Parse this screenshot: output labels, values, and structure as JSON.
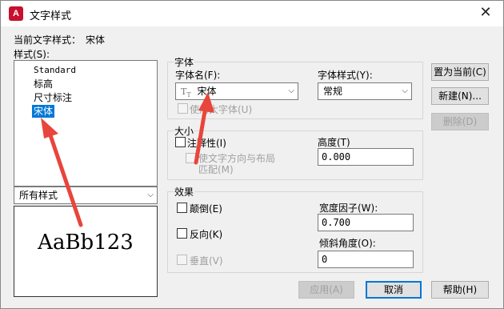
{
  "window": {
    "title": "文字样式",
    "app_icon_letter": "A",
    "close_glyph": "✕"
  },
  "current_style": {
    "label": "当前文字样式：",
    "value": "宋体"
  },
  "styles_list": {
    "label": "样式(S):",
    "items": [
      "Standard",
      "标高",
      "尺寸标注",
      "宋体"
    ],
    "selected_index": 3
  },
  "filter": {
    "value": "所有样式"
  },
  "preview": {
    "text": "AaBb123"
  },
  "font_group": {
    "label": "字体",
    "font_name_label": "字体名(F):",
    "font_name_icon": "truetype-font-icon",
    "font_name_value": "宋体",
    "font_style_label": "字体样式(Y):",
    "font_style_value": "常规",
    "big_font_label": "使用大字体(U)"
  },
  "size_group": {
    "label": "大小",
    "annotative_label": "注释性(I)",
    "match_orientation_label_line1": "使文字方向与布局",
    "match_orientation_label_line2": "匹配(M)",
    "height_label": "高度(T)",
    "height_value": "0.000"
  },
  "effects_group": {
    "label": "效果",
    "upside_down_label": "颠倒(E)",
    "backwards_label": "反向(K)",
    "vertical_label": "垂直(V)",
    "width_factor_label": "宽度因子(W):",
    "width_factor_value": "0.700",
    "oblique_label": "倾斜角度(O):",
    "oblique_value": "0"
  },
  "buttons": {
    "set_current": "置为当前(C)",
    "new": "新建(N)...",
    "delete": "删除(D)",
    "apply": "应用(A)",
    "cancel": "取消",
    "help": "帮助(H)"
  },
  "colors": {
    "selection": "#0078d7",
    "annotation_arrow": "#e8453c",
    "app_icon": "#c8102e"
  }
}
